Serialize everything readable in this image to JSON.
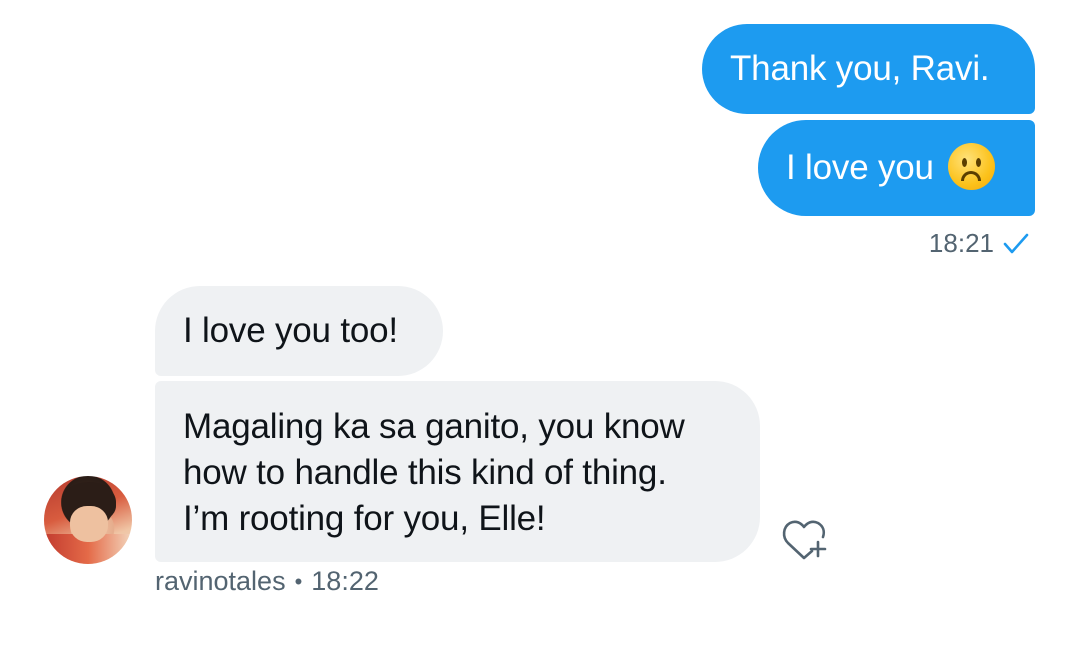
{
  "messages": {
    "sent": [
      {
        "text": "Thank you, Ravi."
      },
      {
        "text": "I love you"
      }
    ],
    "sent_time": "18:21",
    "sent_status_icon": "check-icon",
    "received": [
      {
        "text": "I love you too!"
      },
      {
        "lines": [
          "Magaling ka sa ganito, you know",
          "how to handle this kind of thing.",
          "I’m rooting for you, Elle!"
        ]
      }
    ],
    "received_sender": "ravinotales",
    "received_separator": "•",
    "received_time": "18:22"
  },
  "icons": {
    "emoji": "frowning-face-emoji",
    "reaction": "heart-plus-icon",
    "avatar": "user-avatar"
  },
  "colors": {
    "sent_bubble": "#1d9bf0",
    "received_bubble": "#eff1f3",
    "meta_text": "#536471",
    "check": "#1d9bf0"
  }
}
